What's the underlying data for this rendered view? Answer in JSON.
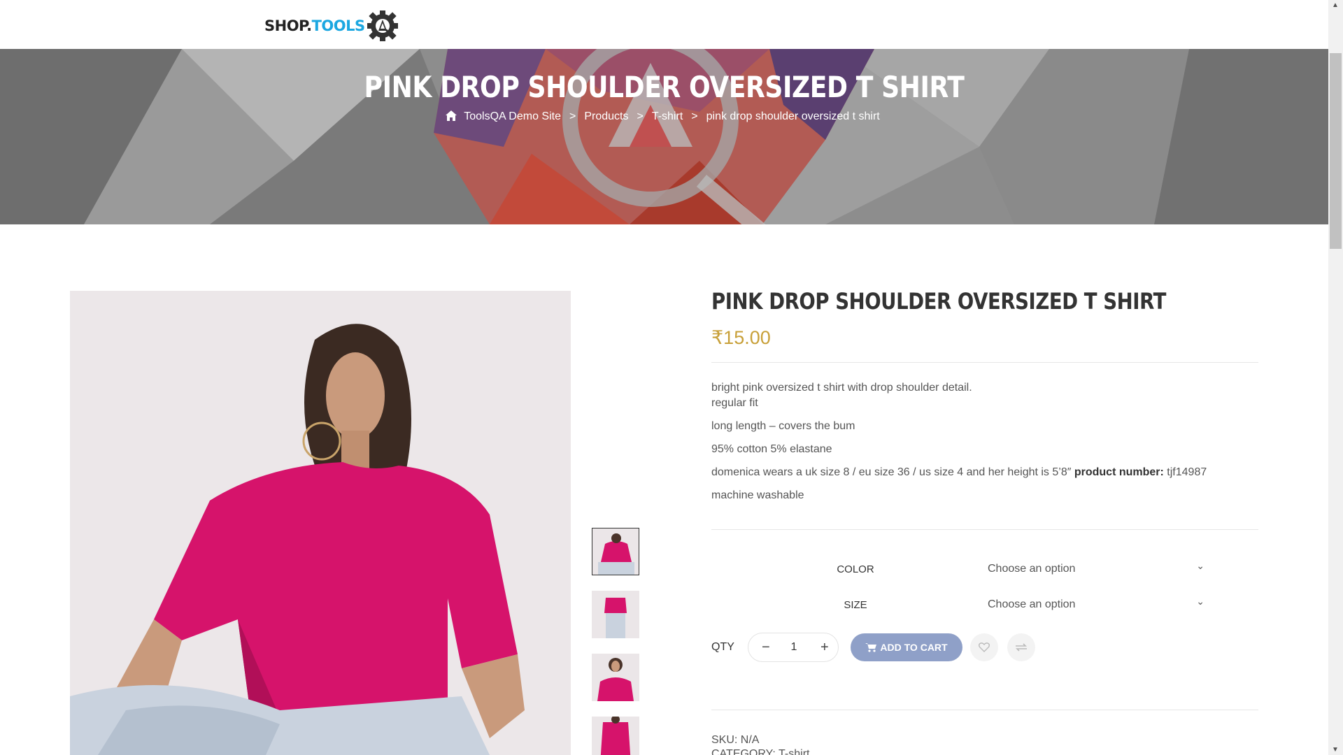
{
  "brand": {
    "part1": "SHOP.",
    "part2": "TOOLS"
  },
  "banner": {
    "title": "PINK DROP SHOULDER OVERSIZED T SHIRT",
    "breadcrumb": [
      "ToolsQA Demo Site",
      "Products",
      "T-shirt",
      "pink drop shoulder oversized t shirt"
    ],
    "separator": ">"
  },
  "product": {
    "title": "PINK DROP SHOULDER OVERSIZED T SHIRT",
    "price": "₹15.00",
    "description": {
      "line1": "bright pink oversized t shirt with drop shoulder detail.",
      "line2": "regular fit",
      "line3": "long length – covers the bum",
      "line4": "95% cotton 5% elastane",
      "line5_text": "domenica wears a uk size 8 / eu size 36 / us size 4 and her height is 5’8″",
      "line5_bold": "product number:",
      "line5_end": "tjf14987",
      "line6": "machine washable"
    },
    "variations": [
      {
        "label": "COLOR",
        "value": "Choose an option"
      },
      {
        "label": "SIZE",
        "value": "Choose an option"
      }
    ],
    "qty_label": "QTY",
    "qty_minus": "−",
    "qty_value": "1",
    "qty_plus": "+",
    "add_to_cart": "ADD TO CART",
    "sku": "SKU: N/A",
    "category": "CATEGORY: T-shirt"
  },
  "colors": {
    "price": "#c8a039",
    "cart_button": "#8fa0c8",
    "shirt": "#d6136b",
    "brand_blue": "#1ba7e1"
  },
  "icons": [
    "home-icon",
    "gear-logo-icon",
    "chevron-down-icon",
    "cart-icon",
    "heart-icon",
    "compare-icon"
  ]
}
